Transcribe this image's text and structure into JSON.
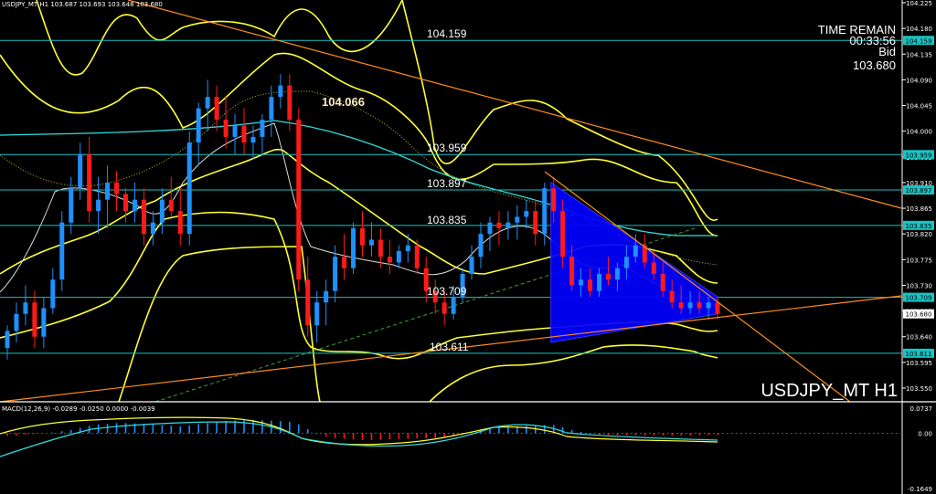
{
  "header": {
    "symbol_line": "USDJPY_MT,H1 103.687 103.693 103.648 103.680",
    "macd_line": "MACD(12,26,9) -0.0289 -0.0250 0.0000 -0.0039"
  },
  "info_box": {
    "line1": "TIME REMAIN",
    "line2": "00:33:56",
    "line3": "Bid",
    "line4": "103.680"
  },
  "watermark": "USDJPY_MT H1",
  "colors": {
    "background": "#000000",
    "bull": "#1e90ff",
    "bear": "#ff1a1a",
    "bollinger": "#ffff33",
    "level_line": "#18c3c3",
    "trendline": "#ff8c1a",
    "cyan_ma": "#33dddd",
    "triangle": "#0000ff"
  },
  "chart_data": [
    {
      "type": "candlestick",
      "title": "USDJPY_MT H1",
      "ylim": [
        103.55,
        104.225
      ],
      "y_ticks": [
        "104.225",
        "104.180",
        "104.135",
        "104.090",
        "104.045",
        "104.000",
        "103.955",
        "103.910",
        "103.865",
        "103.820",
        "103.775",
        "103.730",
        "103.685",
        "103.640",
        "103.595",
        "103.550"
      ],
      "price_tags": [
        {
          "label": "104.159",
          "value": 104.159
        },
        {
          "label": "103.959",
          "value": 103.959
        },
        {
          "label": "103.897",
          "value": 103.897
        },
        {
          "label": "103.835",
          "value": 103.835
        },
        {
          "label": "103.709",
          "value": 103.709
        },
        {
          "label": "103.680",
          "value": 103.68
        },
        {
          "label": "103.611",
          "value": 103.611
        }
      ],
      "horizontal_levels": [
        {
          "label": "104.159",
          "value": 104.159
        },
        {
          "label": "103.959",
          "value": 103.959
        },
        {
          "label": "103.897",
          "value": 103.897
        },
        {
          "label": "103.835",
          "value": 103.835
        },
        {
          "label": "103.709",
          "value": 103.709
        },
        {
          "label": "103.611",
          "value": 103.611
        }
      ],
      "annotation": {
        "label": "104.066",
        "value": 104.066
      },
      "ohlc": [
        [
          103.62,
          103.66,
          103.6,
          103.65
        ],
        [
          103.65,
          103.7,
          103.63,
          103.68
        ],
        [
          103.68,
          103.73,
          103.66,
          103.7
        ],
        [
          103.7,
          103.72,
          103.62,
          103.64
        ],
        [
          103.64,
          103.71,
          103.62,
          103.69
        ],
        [
          103.69,
          103.76,
          103.68,
          103.74
        ],
        [
          103.74,
          103.86,
          103.72,
          103.84
        ],
        [
          103.84,
          103.92,
          103.82,
          103.9
        ],
        [
          103.9,
          103.98,
          103.88,
          103.96
        ],
        [
          103.96,
          103.99,
          103.84,
          103.86
        ],
        [
          103.86,
          103.92,
          103.82,
          103.88
        ],
        [
          103.88,
          103.94,
          103.83,
          103.91
        ],
        [
          103.91,
          103.93,
          103.86,
          103.89
        ],
        [
          103.89,
          103.9,
          103.84,
          103.86
        ],
        [
          103.86,
          103.91,
          103.84,
          103.88
        ],
        [
          103.88,
          103.9,
          103.8,
          103.82
        ],
        [
          103.82,
          103.86,
          103.8,
          103.84
        ],
        [
          103.84,
          103.9,
          103.82,
          103.88
        ],
        [
          103.88,
          103.92,
          103.85,
          103.86
        ],
        [
          103.86,
          103.9,
          103.8,
          103.82
        ],
        [
          103.82,
          104.0,
          103.8,
          103.98
        ],
        [
          103.98,
          104.05,
          103.94,
          104.04
        ],
        [
          104.04,
          104.09,
          104.0,
          104.06
        ],
        [
          104.06,
          104.08,
          104.0,
          104.02
        ],
        [
          104.02,
          104.06,
          103.97,
          103.99
        ],
        [
          103.99,
          104.03,
          103.96,
          104.01
        ],
        [
          104.01,
          104.04,
          103.96,
          103.98
        ],
        [
          103.98,
          104.01,
          103.95,
          103.99
        ],
        [
          103.99,
          104.03,
          103.96,
          104.02
        ],
        [
          104.02,
          104.08,
          103.99,
          104.06
        ],
        [
          104.06,
          104.1,
          104.04,
          104.08
        ],
        [
          104.08,
          104.1,
          104.0,
          104.02
        ],
        [
          104.02,
          104.04,
          103.72,
          103.74
        ],
        [
          103.74,
          103.78,
          103.64,
          103.66
        ],
        [
          103.66,
          103.72,
          103.63,
          103.7
        ],
        [
          103.7,
          103.74,
          103.66,
          103.72
        ],
        [
          103.72,
          103.8,
          103.7,
          103.78
        ],
        [
          103.78,
          103.82,
          103.74,
          103.76
        ],
        [
          103.76,
          103.84,
          103.75,
          103.83
        ],
        [
          103.83,
          103.86,
          103.78,
          103.8
        ],
        [
          103.8,
          103.84,
          103.78,
          103.81
        ],
        [
          103.81,
          103.83,
          103.76,
          103.78
        ],
        [
          103.78,
          103.81,
          103.75,
          103.77
        ],
        [
          103.77,
          103.8,
          103.76,
          103.79
        ],
        [
          103.79,
          103.82,
          103.77,
          103.8
        ],
        [
          103.8,
          103.81,
          103.75,
          103.76
        ],
        [
          103.76,
          103.78,
          103.7,
          103.72
        ],
        [
          103.72,
          103.74,
          103.68,
          103.7
        ],
        [
          103.7,
          103.72,
          103.66,
          103.68
        ],
        [
          103.68,
          103.73,
          103.67,
          103.71
        ],
        [
          103.71,
          103.76,
          103.7,
          103.75
        ],
        [
          103.75,
          103.8,
          103.74,
          103.78
        ],
        [
          103.78,
          103.84,
          103.76,
          103.82
        ],
        [
          103.82,
          103.85,
          103.79,
          103.84
        ],
        [
          103.84,
          103.86,
          103.8,
          103.83
        ],
        [
          103.83,
          103.86,
          103.81,
          103.84
        ],
        [
          103.84,
          103.87,
          103.81,
          103.85
        ],
        [
          103.85,
          103.88,
          103.83,
          103.86
        ],
        [
          103.86,
          103.88,
          103.8,
          103.82
        ],
        [
          103.82,
          103.91,
          103.8,
          103.9
        ],
        [
          103.9,
          103.92,
          103.84,
          103.86
        ],
        [
          103.86,
          103.88,
          103.76,
          103.78
        ],
        [
          103.78,
          103.8,
          103.72,
          103.73
        ],
        [
          103.73,
          103.76,
          103.71,
          103.74
        ],
        [
          103.74,
          103.76,
          103.71,
          103.72
        ],
        [
          103.72,
          103.76,
          103.71,
          103.75
        ],
        [
          103.75,
          103.78,
          103.73,
          103.74
        ],
        [
          103.74,
          103.77,
          103.72,
          103.76
        ],
        [
          103.76,
          103.8,
          103.74,
          103.78
        ],
        [
          103.78,
          103.82,
          103.77,
          103.8
        ],
        [
          103.8,
          103.82,
          103.76,
          103.77
        ],
        [
          103.77,
          103.79,
          103.74,
          103.75
        ],
        [
          103.75,
          103.77,
          103.71,
          103.72
        ],
        [
          103.72,
          103.74,
          103.69,
          103.7
        ],
        [
          103.7,
          103.73,
          103.68,
          103.69
        ],
        [
          103.69,
          103.72,
          103.68,
          103.7
        ],
        [
          103.7,
          103.72,
          103.68,
          103.69
        ],
        [
          103.69,
          103.71,
          103.67,
          103.7
        ],
        [
          103.7,
          103.71,
          103.67,
          103.68
        ]
      ]
    },
    {
      "type": "bar",
      "title": "MACD(12,26,9)",
      "ylim": [
        -0.1649,
        0.0737
      ],
      "y_ticks": [
        "0.0737",
        "0.00",
        "-0.1649"
      ],
      "histogram": [
        -0.008,
        -0.006,
        -0.004,
        -0.002,
        0.0,
        0.002,
        0.006,
        0.01,
        0.016,
        0.022,
        0.026,
        0.028,
        0.03,
        0.03,
        0.029,
        0.028,
        0.026,
        0.024,
        0.022,
        0.02,
        0.022,
        0.026,
        0.03,
        0.034,
        0.036,
        0.038,
        0.039,
        0.039,
        0.038,
        0.037,
        0.036,
        0.034,
        0.026,
        0.012,
        -0.002,
        -0.01,
        -0.014,
        -0.016,
        -0.018,
        -0.02,
        -0.02,
        -0.019,
        -0.018,
        -0.017,
        -0.016,
        -0.015,
        -0.015,
        -0.014,
        -0.013,
        -0.01,
        -0.004,
        0.002,
        0.008,
        0.012,
        0.016,
        0.018,
        0.02,
        0.022,
        0.022,
        0.024,
        0.024,
        0.018,
        0.01,
        0.004,
        -0.002,
        -0.004,
        -0.005,
        -0.006,
        -0.006,
        -0.006,
        -0.006,
        -0.006,
        -0.006,
        -0.006,
        -0.006,
        -0.006,
        -0.005,
        -0.005,
        -0.005
      ]
    }
  ]
}
